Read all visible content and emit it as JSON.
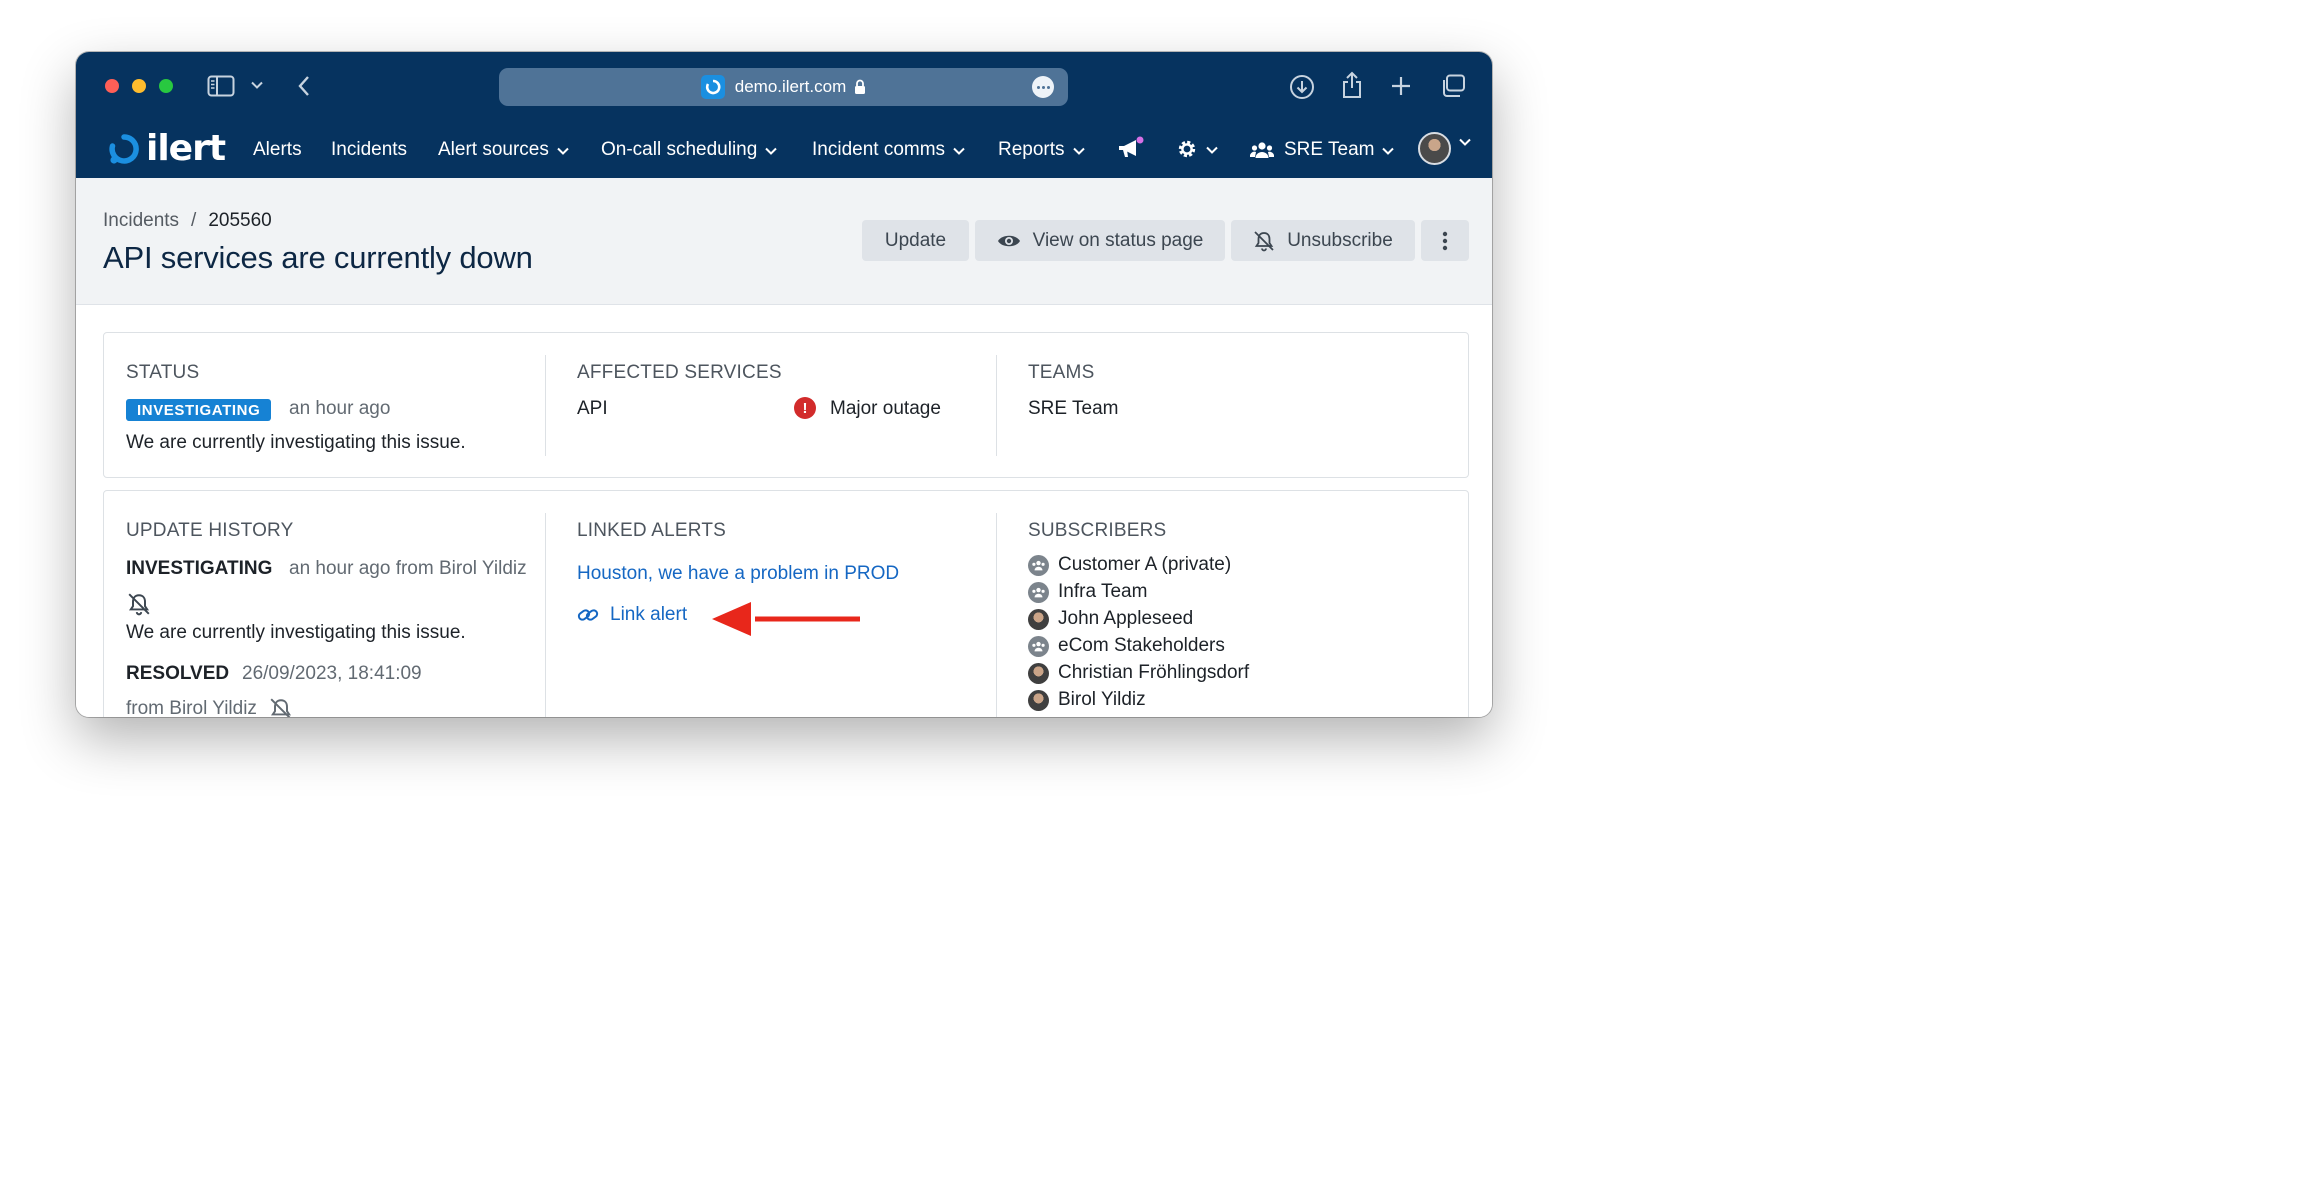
{
  "browser": {
    "url": "demo.ilert.com"
  },
  "nav": {
    "logo_text": "ilert",
    "items": [
      {
        "label": "Alerts"
      },
      {
        "label": "Incidents"
      },
      {
        "label": "Alert sources"
      },
      {
        "label": "On-call scheduling"
      },
      {
        "label": "Incident comms"
      },
      {
        "label": "Reports"
      }
    ],
    "team_label": "SRE Team"
  },
  "header": {
    "breadcrumb_parent": "Incidents",
    "breadcrumb_separator": "/",
    "breadcrumb_current": "205560",
    "title": "API services are currently down",
    "update_label": "Update",
    "status_page_label": "View on status page",
    "unsubscribe_label": "Unsubscribe"
  },
  "status_card": {
    "status": {
      "title": "STATUS",
      "badge": "INVESTIGATING",
      "time": "an hour ago",
      "message": "We are currently investigating this issue."
    },
    "affected": {
      "title": "AFFECTED SERVICES",
      "service": "API",
      "service_status": "Major outage",
      "status_color": "#d22b2b"
    },
    "teams": {
      "title": "TEAMS",
      "team": "SRE Team"
    }
  },
  "details_card": {
    "history": {
      "title": "UPDATE HISTORY",
      "entries": [
        {
          "status": "INVESTIGATING",
          "meta": "an hour ago from Birol Yildiz",
          "message": "We are currently investigating this issue."
        },
        {
          "status": "RESOLVED",
          "meta": "26/09/2023, 18:41:09",
          "author": "from Birol Yildiz"
        }
      ]
    },
    "linked_alerts": {
      "title": "LINKED ALERTS",
      "alert": "Houston, we have a problem in PROD",
      "link_label": "Link alert"
    },
    "subscribers": {
      "title": "SUBSCRIBERS",
      "items": [
        {
          "name": "Customer A (private)",
          "type": "group"
        },
        {
          "name": "Infra Team",
          "type": "group"
        },
        {
          "name": "John Appleseed",
          "type": "user"
        },
        {
          "name": "eCom Stakeholders",
          "type": "group"
        },
        {
          "name": "Christian Fröhlingsdorf",
          "type": "user"
        },
        {
          "name": "Birol Yildiz",
          "type": "user"
        }
      ]
    }
  },
  "colors": {
    "nav_bg": "#06335f",
    "accent": "#1682d4",
    "link": "#1567c3",
    "annotation_arrow": "#e8271b"
  }
}
